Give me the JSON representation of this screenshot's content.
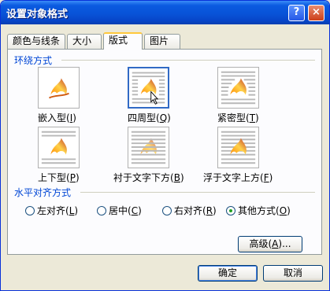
{
  "window": {
    "title": "设置对象格式",
    "help_glyph": "?",
    "close_glyph": "×"
  },
  "tabs": [
    {
      "label": "颜色与线条",
      "active": false
    },
    {
      "label": "大小",
      "active": false
    },
    {
      "label": "版式",
      "active": true
    },
    {
      "label": "图片",
      "active": false
    }
  ],
  "wrapping": {
    "group_label": "环绕方式",
    "options": [
      {
        "label": "嵌入型",
        "key": "I",
        "icon": "inline-wrap-icon",
        "selected": false
      },
      {
        "label": "四周型",
        "key": "Q",
        "icon": "square-wrap-icon",
        "selected": true
      },
      {
        "label": "紧密型",
        "key": "T",
        "icon": "tight-wrap-icon",
        "selected": false
      },
      {
        "label": "上下型",
        "key": "P",
        "icon": "top-bottom-wrap-icon",
        "selected": false
      },
      {
        "label": "衬于文字下方",
        "key": "B",
        "icon": "behind-text-icon",
        "selected": false
      },
      {
        "label": "浮于文字上方",
        "key": "F",
        "icon": "in-front-of-text-icon",
        "selected": false
      }
    ]
  },
  "alignment": {
    "group_label": "水平对齐方式",
    "options": [
      {
        "label": "左对齐",
        "key": "L",
        "checked": false
      },
      {
        "label": "居中",
        "key": "C",
        "checked": false
      },
      {
        "label": "右对齐",
        "key": "R",
        "checked": false
      },
      {
        "label": "其他方式",
        "key": "O",
        "checked": true
      }
    ]
  },
  "buttons": {
    "advanced": "高级",
    "advanced_key": "A",
    "advanced_suffix": "...",
    "ok": "确定",
    "cancel": "取消"
  },
  "colors": {
    "accent": "#316ac5",
    "group_label": "#0046d5",
    "title_bar": "#0853d8"
  }
}
